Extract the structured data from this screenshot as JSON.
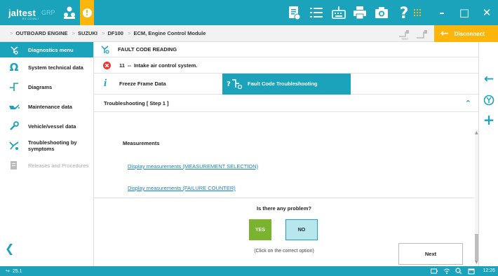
{
  "app": {
    "logo_text": "jaltest",
    "logo_suffix": "GRP",
    "logo_subtext": "BY COJALI",
    "brand_color": "#1aa3bb",
    "warning_color": "#fbb50b"
  },
  "toolbar_icons": [
    "report-icon",
    "list-icon",
    "keyboard-icon",
    "print-icon",
    "camera-icon",
    "help-icon",
    "apps-grid-icon"
  ],
  "window_controls": {
    "minimize": "–",
    "maximize": "□",
    "close": "✕"
  },
  "breadcrumb": {
    "items": [
      "OUTBOARD ENGINE",
      "SUZUKI",
      "DF100",
      "ECM, Engine Control Module"
    ]
  },
  "disconnect_label": "Disconnect",
  "sidebar": {
    "items": [
      {
        "label": "Diagnostics menu",
        "icon": "diagnostics-icon",
        "active": true
      },
      {
        "label": "System technical data",
        "icon": "omega-icon"
      },
      {
        "label": "Diagrams",
        "icon": "diagram-icon"
      },
      {
        "label": "Maintenance data",
        "icon": "oil-can-icon"
      },
      {
        "label": "Vehicle/vessel data",
        "icon": "wrench-icon"
      },
      {
        "label": "Troubleshooting by symptoms",
        "icon": "symptoms-icon"
      },
      {
        "label": "Releases and Procedures",
        "icon": "document-icon",
        "disabled": true
      }
    ]
  },
  "main": {
    "section_title": "FAULT CODE READING",
    "fault": {
      "code": "11",
      "separator": "--",
      "description": "Intake air control system."
    },
    "tabs": [
      {
        "label": "Freeze Frame Data",
        "active": false
      },
      {
        "label": "Fault Code Troubleshooting",
        "active": true
      }
    ],
    "step_title": "Troubleshooting [ Step 1 ]",
    "measurements_title": "Measurements",
    "links": [
      "Display measurements (MEASUREMENT SELECTION)",
      "Display measurements (FAILURE COUNTER)"
    ],
    "question": "Is there any problem?",
    "yes_label": "YES",
    "no_label": "NO",
    "hint": "(Click on the correct option)",
    "next_label": "Next"
  },
  "status": {
    "version": "25.1",
    "time": "12:26"
  }
}
